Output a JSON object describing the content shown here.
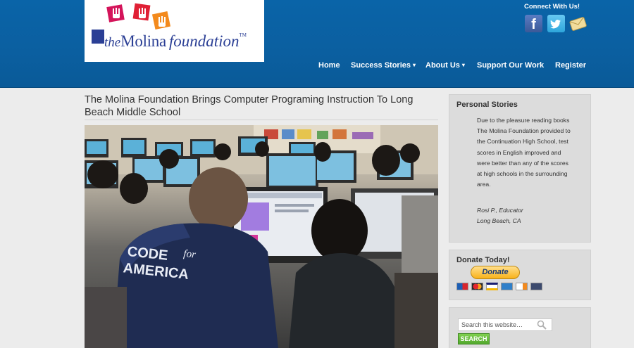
{
  "logo": {
    "the": "the",
    "molina": "Molina",
    "foundation": "foundation",
    "tm": "TM"
  },
  "connect": {
    "label": "Connect With Us!",
    "facebook_glyph": "f",
    "twitter_glyph": "t",
    "icons": [
      "facebook-icon",
      "twitter-icon",
      "mail-icon"
    ]
  },
  "nav": {
    "items": [
      {
        "label": "Home"
      },
      {
        "label": "Success Stories",
        "arrow": "▾"
      },
      {
        "label": "About Us",
        "arrow": "▾"
      },
      {
        "label": "Support Our Work"
      },
      {
        "label": "Register"
      }
    ]
  },
  "article": {
    "title": "The Molina Foundation Brings Computer Programing Instruction To Long Beach Middle School",
    "photo_jacket_text": {
      "line1": "CODE",
      "for": "for",
      "line2": "AMERICA"
    }
  },
  "personal_stories": {
    "heading": "Personal Stories",
    "quote": "Due to the pleasure reading books The Molina Foundation provided to the Continuation High School, test scores in English improved and were better than any of the scores at high schools in the surrounding area.",
    "author": "Rosi P., Educator",
    "location": "Long Beach, CA"
  },
  "donate": {
    "heading": "Donate Today!",
    "button_label": "Donate",
    "cards": [
      "maestro",
      "mastercard",
      "visa",
      "amex",
      "discover",
      "bank"
    ]
  },
  "search": {
    "value": "Search this website…",
    "button_label": "SEARCH"
  },
  "colors": {
    "header_blue": "#0a64a8",
    "logo_blue": "#2b3f95",
    "search_green": "#52a82d",
    "donate_gold": "#f9b21b"
  }
}
